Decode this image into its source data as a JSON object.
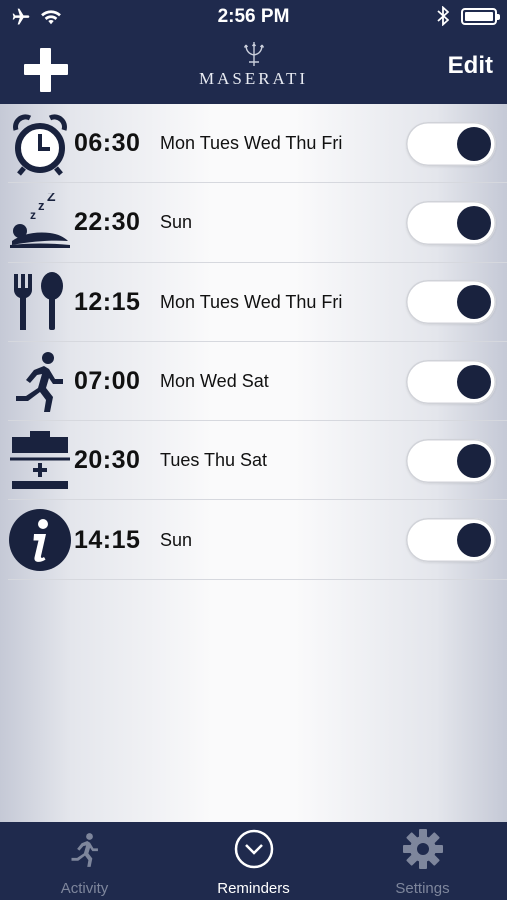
{
  "status_bar": {
    "time": "2:56 PM"
  },
  "header": {
    "brand": "MASERATI",
    "edit_label": "Edit"
  },
  "reminders": [
    {
      "icon": "alarm-clock-icon",
      "time": "06:30",
      "days": "Mon Tues Wed Thu Fri",
      "enabled": true
    },
    {
      "icon": "sleep-icon",
      "time": "22:30",
      "days": "Sun",
      "enabled": true
    },
    {
      "icon": "meal-icon",
      "time": "12:15",
      "days": "Mon Tues Wed Thu Fri",
      "enabled": true
    },
    {
      "icon": "running-icon",
      "time": "07:00",
      "days": "Mon Wed Sat",
      "enabled": true
    },
    {
      "icon": "scale-icon",
      "time": "20:30",
      "days": "Tues Thu Sat",
      "enabled": true
    },
    {
      "icon": "info-icon",
      "time": "14:15",
      "days": "Sun",
      "enabled": true
    }
  ],
  "tabs": [
    {
      "label": "Activity",
      "icon": "running-icon",
      "active": false
    },
    {
      "label": "Reminders",
      "icon": "clock-icon",
      "active": true
    },
    {
      "label": "Settings",
      "icon": "gear-icon",
      "active": false
    }
  ],
  "colors": {
    "navy": "#1f2a4d",
    "toggle_knob": "#19223e",
    "inactive_tab": "#7e869c"
  }
}
